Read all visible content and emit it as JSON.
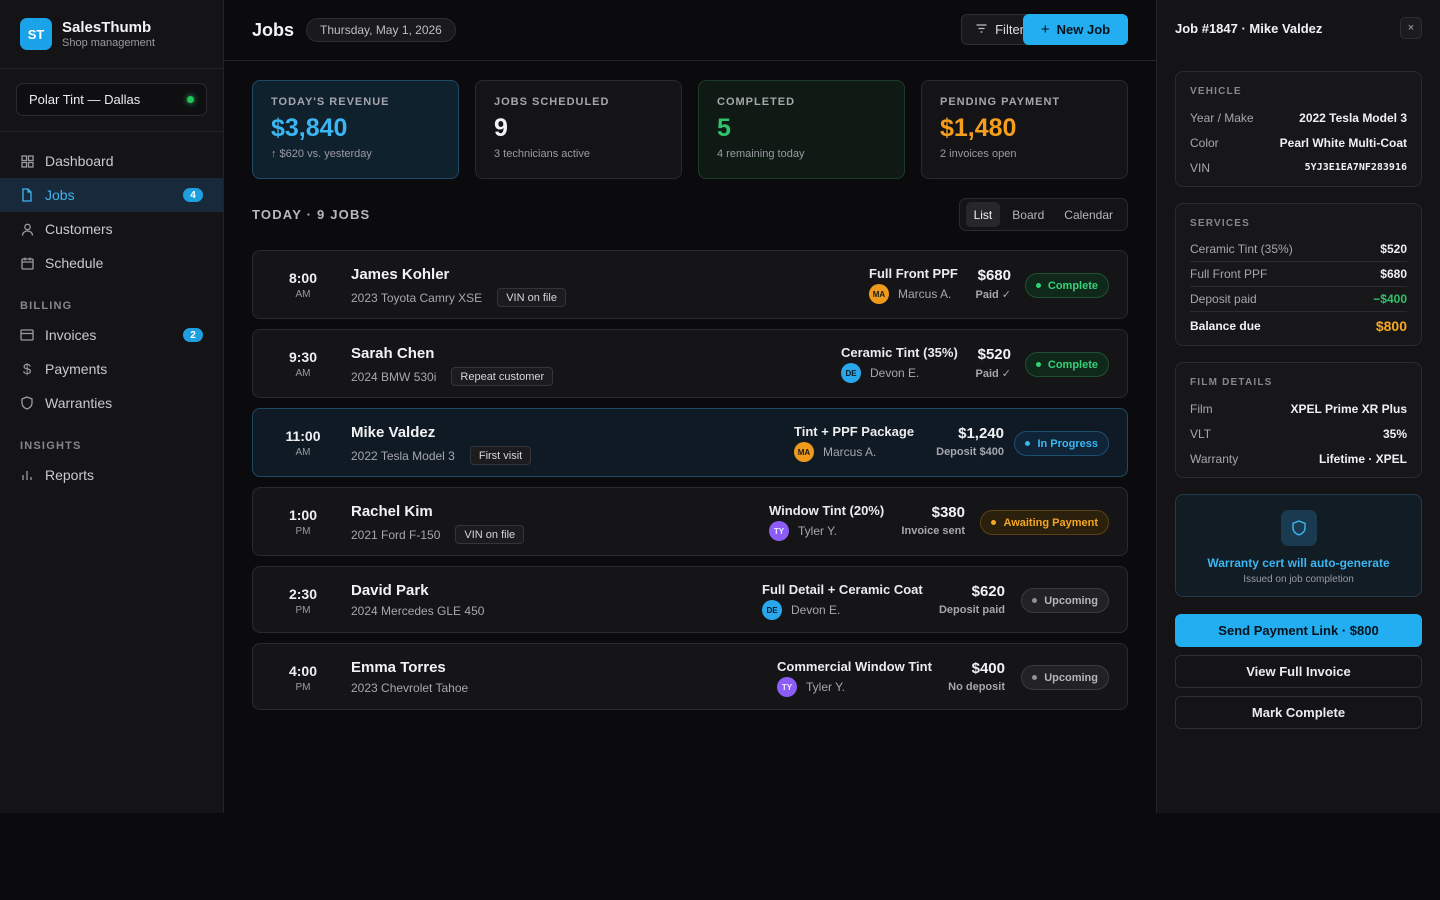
{
  "brand": {
    "logo": "ST",
    "name": "SalesThumb",
    "subtitle": "Shop management"
  },
  "shop": {
    "name": "Polar Tint — Dallas",
    "status_color": "#22c55e"
  },
  "nav": {
    "main": [
      {
        "label": "Dashboard",
        "icon": "grid-icon",
        "active": false
      },
      {
        "label": "Jobs",
        "icon": "file-icon",
        "active": true,
        "badge": "4"
      },
      {
        "label": "Customers",
        "icon": "user-icon",
        "active": false
      },
      {
        "label": "Schedule",
        "icon": "calendar-icon",
        "active": false
      }
    ],
    "billing_title": "BILLING",
    "billing": [
      {
        "label": "Invoices",
        "icon": "card-icon",
        "badge": "2"
      },
      {
        "label": "Payments",
        "icon": "dollar-icon"
      },
      {
        "label": "Warranties",
        "icon": "shield-icon"
      }
    ],
    "insights_title": "INSIGHTS",
    "insights": [
      {
        "label": "Reports",
        "icon": "bar-chart-icon"
      }
    ]
  },
  "header": {
    "title": "Jobs",
    "date": "Thursday, May 1, 2026",
    "filter_label": "Filter",
    "new_label": "New Job"
  },
  "stats": [
    {
      "label": "TODAY'S REVENUE",
      "value": "$3,840",
      "sub": "↑ $620 vs. yesterday"
    },
    {
      "label": "JOBS SCHEDULED",
      "value": "9",
      "sub": "3 technicians active"
    },
    {
      "label": "COMPLETED",
      "value": "5",
      "sub": "4 remaining today"
    },
    {
      "label": "PENDING PAYMENT",
      "value": "$1,480",
      "sub": "2 invoices open"
    }
  ],
  "jobs_section": {
    "title": "TODAY · 9 JOBS",
    "views": [
      "List",
      "Board",
      "Calendar"
    ],
    "active_view": "List"
  },
  "jobs": [
    {
      "time": "8:00",
      "ampm": "AM",
      "customer": "James Kohler",
      "vehicle": "2023 Toyota Camry XSE",
      "tag": "VIN on file",
      "service": "Full Front PPF",
      "tech_initials": "MA",
      "tech": "Marcus A.",
      "price": "$680",
      "price_sub": "Paid ✓",
      "status": "Complete"
    },
    {
      "time": "9:30",
      "ampm": "AM",
      "customer": "Sarah Chen",
      "vehicle": "2024 BMW 530i",
      "tag": "Repeat customer",
      "service": "Ceramic Tint (35%)",
      "tech_initials": "DE",
      "tech": "Devon E.",
      "price": "$520",
      "price_sub": "Paid ✓",
      "status": "Complete"
    },
    {
      "time": "11:00",
      "ampm": "AM",
      "customer": "Mike Valdez",
      "vehicle": "2022 Tesla Model 3",
      "tag": "First visit",
      "service": "Tint + PPF Package",
      "tech_initials": "MA",
      "tech": "Marcus A.",
      "price": "$1,240",
      "price_sub": "Deposit $400",
      "status": "In Progress"
    },
    {
      "time": "1:00",
      "ampm": "PM",
      "customer": "Rachel Kim",
      "vehicle": "2021 Ford F-150",
      "tag": "VIN on file",
      "service": "Window Tint (20%)",
      "tech_initials": "TY",
      "tech": "Tyler Y.",
      "price": "$380",
      "price_sub": "Invoice sent",
      "status": "Awaiting Payment"
    },
    {
      "time": "2:30",
      "ampm": "PM",
      "customer": "David Park",
      "vehicle": "2024 Mercedes GLE 450",
      "tag": "",
      "service": "Full Detail + Ceramic Coat",
      "tech_initials": "DE",
      "tech": "Devon E.",
      "price": "$620",
      "price_sub": "Deposit paid",
      "status": "Upcoming"
    },
    {
      "time": "4:00",
      "ampm": "PM",
      "customer": "Emma Torres",
      "vehicle": "2023 Chevrolet Tahoe",
      "tag": "",
      "service": "Commercial Window Tint",
      "tech_initials": "TY",
      "tech": "Tyler Y.",
      "price": "$400",
      "price_sub": "No deposit",
      "status": "Upcoming"
    }
  ],
  "panel": {
    "title": "Job #1847 · Mike Valdez",
    "close": "×",
    "vehicle": {
      "label": "VEHICLE",
      "rows": [
        {
          "k": "Year / Make",
          "v": "2022 Tesla Model 3"
        },
        {
          "k": "Color",
          "v": "Pearl White Multi-Coat"
        },
        {
          "k": "VIN",
          "v": "5YJ3E1EA7NF283916"
        }
      ]
    },
    "services": {
      "label": "SERVICES",
      "rows": [
        {
          "k": "Ceramic Tint (35%)",
          "v": "$520"
        },
        {
          "k": "Full Front PPF",
          "v": "$680"
        },
        {
          "k": "Deposit paid",
          "v": "−$400"
        },
        {
          "k": "Balance due",
          "v": "$800"
        }
      ]
    },
    "film": {
      "label": "FILM DETAILS",
      "rows": [
        {
          "k": "Film",
          "v": "XPEL Prime XR Plus"
        },
        {
          "k": "VLT",
          "v": "35%"
        },
        {
          "k": "Warranty",
          "v": "Lifetime · XPEL"
        }
      ]
    },
    "warranty": {
      "title": "Warranty cert will auto-generate",
      "sub": "Issued on job completion"
    },
    "buttons": {
      "send": "Send Payment Link · $800",
      "invoice": "View Full Invoice",
      "complete": "Mark Complete"
    }
  },
  "colors": {
    "accent": "#22aef0",
    "success": "#2fc26a",
    "warning": "#f59e1b",
    "background": "#0b0b0d"
  }
}
